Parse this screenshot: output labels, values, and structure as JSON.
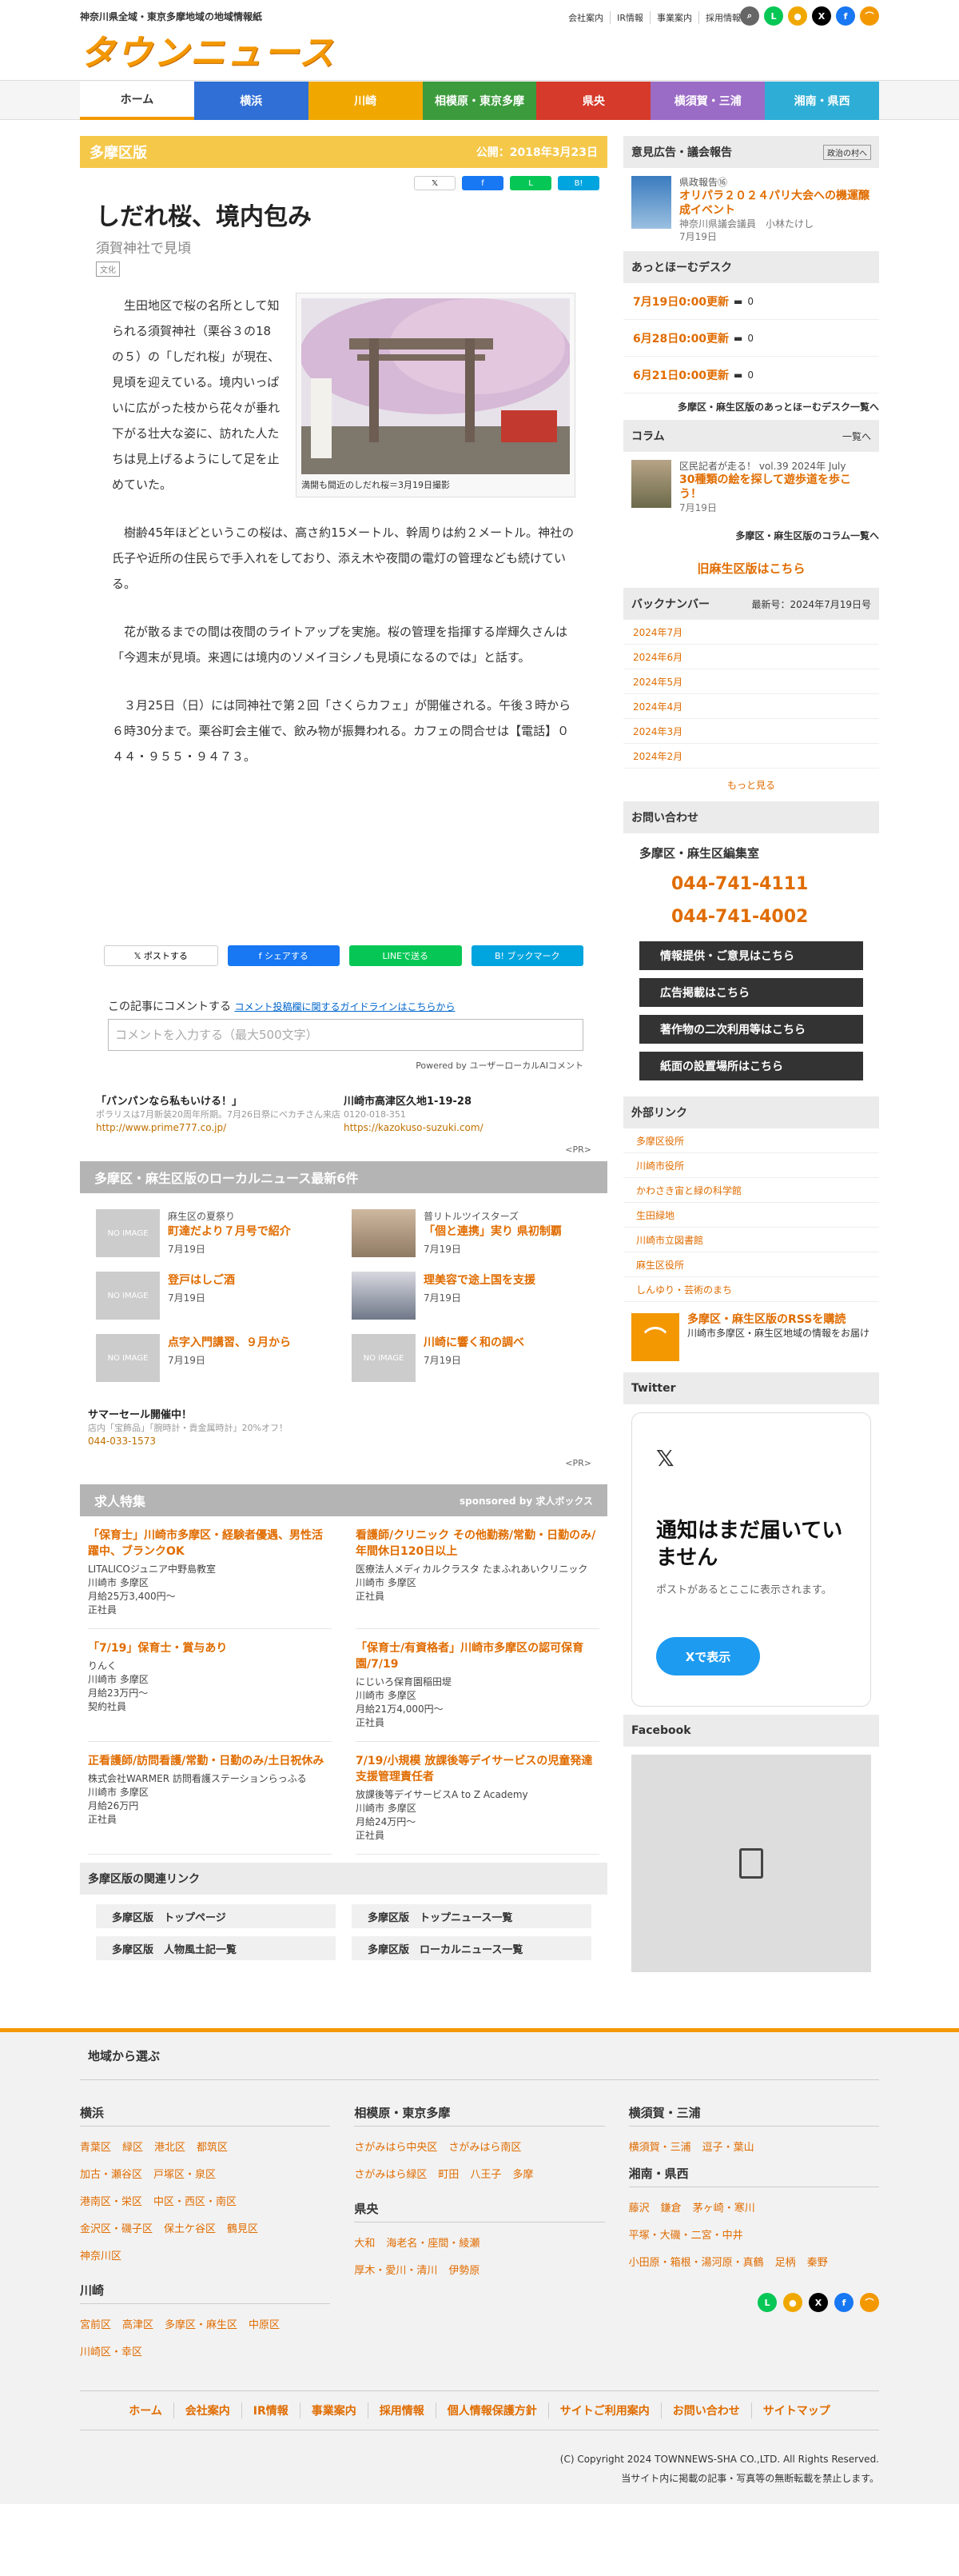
{
  "header": {
    "tagline": "神奈川県全域・東京多摩地域の地域情報紙",
    "logo": "タウンニュース",
    "links": [
      "会社案内",
      "IR情報",
      "事業案内",
      "採用情報"
    ]
  },
  "nav": [
    "ホーム",
    "横浜",
    "川崎",
    "相模原・東京多摩",
    "県央",
    "横須賀・三浦",
    "湘南・県西"
  ],
  "nav_colors": [
    "#ffffff",
    "#2f6fd6",
    "#f0a800",
    "#3c9b3c",
    "#d63a2a",
    "#9b6cc6",
    "#2eaed6"
  ],
  "article": {
    "area": "多摩区版",
    "published": "公開：2018年3月23日",
    "title": "しだれ桜、境内包み",
    "subtitle": "須賀神社で見頃",
    "tag": "文化",
    "caption": "満開も間近のしだれ桜＝3月19日撮影",
    "paragraphs": [
      "生田地区で桜の名所として知られる須賀神社（栗谷３の18の５）の「しだれ桜」が現在、見頃を迎えている。境内いっぱいに広がった枝から花々が垂れ下がる壮大な姿に、訪れた人たちは見上げるようにして足を止めていた。",
      "樹齢45年ほどというこの桜は、高さ約15メートル、幹周りは約２メートル。神社の氏子や近所の住民らで手入れをしており、添え木や夜間の電灯の管理なども続けている。",
      "花が散るまでの間は夜間のライトアップを実施。桜の管理を指揮する岸輝久さんは「今週末が見頃。来週には境内のソメイヨシノも見頃になるのでは」と話す。",
      "３月25日（日）には同神社で第２回「さくらカフェ」が開催される。午後３時から６時30分まで。栗谷町会主催で、飲み物が振舞われる。カフェの問合せは【電話】０４４・９５５・９４７３。"
    ]
  },
  "share": {
    "post": "ポストする",
    "fb": "シェアする",
    "line": "LINEで送る",
    "hb": "ブックマーク"
  },
  "comment": {
    "label": "この記事にコメントする",
    "guide": "コメント投稿欄に関するガイドラインはこちらから",
    "placeholder": "コメントを入力する（最大500文字）",
    "powered": "Powered by ユーザーローカルAIコメント"
  },
  "ads": [
    {
      "title": "「パンパンなら私もいける！」",
      "desc": "ポラリスは7月新装20周年所期。7月26日祭にべカチさん来店",
      "url": "http://www.prime777.co.jp/"
    },
    {
      "title": "川崎市高津区久地1-19-28",
      "desc": "0120-018-351",
      "url": "https://kazokuso-suzuki.com/"
    }
  ],
  "pr": "<PR>",
  "local": {
    "heading": "多摩区・麻生区版のローカルニュース最新6件",
    "items": [
      {
        "kicker": "麻生区の夏祭り",
        "title": "町達だより７月号で紹介",
        "date": "7月19日",
        "photo": false
      },
      {
        "kicker": "普リトルツイスターズ",
        "title": "「個と連携」実り 県初制覇",
        "date": "7月19日",
        "photo": true
      },
      {
        "kicker": "",
        "title": "登戸はしご酒",
        "date": "7月19日",
        "photo": false
      },
      {
        "kicker": "",
        "title": "理美容で途上国を支援",
        "date": "7月19日",
        "photo": true
      },
      {
        "kicker": "",
        "title": "点字入門講習、９月から",
        "date": "7月19日",
        "photo": false
      },
      {
        "kicker": "",
        "title": "川崎に響く和の調べ",
        "date": "7月19日",
        "photo": false
      }
    ],
    "noimage": "NO IMAGE"
  },
  "sale": {
    "title": "サマーセール開催中！",
    "desc": "店内「宝飾品」「腕時計・貴金属時計」20%オフ！",
    "tel": "044-033-1573"
  },
  "jobs": {
    "heading": "求人特集",
    "sponsor": "sponsored by 求人ボックス",
    "items": [
      {
        "title": "「保育士」川崎市多摩区・経験者優遇、男性活躍中、ブランクOK",
        "company": "LITALICOジュニア中野島教室",
        "loc": "川崎市 多摩区",
        "pay": "月給25万3,400円〜",
        "type": "正社員"
      },
      {
        "title": "看護師/クリニック その他勤務/常勤・日勤のみ/年間休日120日以上",
        "company": "医療法人メディカルクラスタ たまふれあいクリニック",
        "loc": "川崎市 多摩区",
        "pay": "",
        "type": "正社員"
      },
      {
        "title": "「7/19」保育士・賞与あり",
        "company": "りんく",
        "loc": "川崎市 多摩区",
        "pay": "月給23万円〜",
        "type": "契約社員"
      },
      {
        "title": "「保育士/有資格者」川崎市多摩区の認可保育園/7/19",
        "company": "にじいろ保育園稲田堤",
        "loc": "川崎市 多摩区",
        "pay": "月給21万4,000円〜",
        "type": "正社員"
      },
      {
        "title": "正看護師/訪問看護/常勤・日勤のみ/土日祝休み",
        "company": "株式会社WARMER 訪問看護ステーションらっふる",
        "loc": "川崎市 多摩区",
        "pay": "月給26万円",
        "type": "正社員"
      },
      {
        "title": "7/19/小規模 放課後等デイサービスの児童発達支援管理責任者",
        "company": "放課後等デイサービスA to Z Academy",
        "loc": "川崎市 多摩区",
        "pay": "月給24万円〜",
        "type": "正社員"
      }
    ]
  },
  "related": {
    "heading": "多摩区版の関連リンク",
    "links": [
      "多摩区版　トップページ",
      "多摩区版　トップニュース一覧",
      "多摩区版　人物風土記一覧",
      "多摩区版　ローカルニュース一覧"
    ]
  },
  "side": {
    "ads_heading": "意見広告・議会報告",
    "ads_badge": "政治の村へ",
    "report": {
      "kicker": "県政報告⑯",
      "title": "オリパラ２０２４パリ大会への機運醸成イベント",
      "author": "神奈川県議会議員　小林たけし",
      "date": "7月19日"
    },
    "athome_heading": "あっとほーむデスク",
    "updates": [
      {
        "date": "7月19日0:00更新",
        "count": "0"
      },
      {
        "date": "6月28日0:00更新",
        "count": "0"
      },
      {
        "date": "6月21日0:00更新",
        "count": "0"
      }
    ],
    "athome_more": "多摩区・麻生区版のあっとほーむデスク一覧へ",
    "column_heading": "コラム",
    "column_list": "一覧へ",
    "column": {
      "kicker": "区民記者が走る！ vol.39 2024年 July",
      "title": "30種類の絵を探して遊歩道を歩こう！",
      "date": "7月19日"
    },
    "column_more": "多摩区・麻生区版のコラム一覧へ",
    "old": "旧麻生区版はこちら",
    "backnum_heading": "バックナンバー",
    "backnum_latest": "最新号：2024年7月19日号",
    "backnum": [
      "2024年7月",
      "2024年6月",
      "2024年5月",
      "2024年4月",
      "2024年3月",
      "2024年2月"
    ],
    "backnum_more": "もっと見る",
    "contact_heading": "お問い合わせ",
    "contact_name": "多摩区・麻生区編集室",
    "tel1": "044-741-4111",
    "tel2": "044-741-4002",
    "buttons": [
      "情報提供・ご意見はこちら",
      "広告掲載はこちら",
      "著作物の二次利用等はこちら",
      "紙面の設置場所はこちら"
    ],
    "ext_heading": "外部リンク",
    "ext": [
      "多摩区役所",
      "川崎市役所",
      "かわさき宙と緑の科学館",
      "生田緑地",
      "川崎市立図書館",
      "麻生区役所",
      "しんゆり・芸術のまち"
    ],
    "rss_title": "多摩区・麻生区版のRSSを購読",
    "rss_desc": "川崎市多摩区・麻生区地域の情報をお届け",
    "twitter_heading": "Twitter",
    "tw_title": "通知はまだ届いていません",
    "tw_desc": "ポストがあるとここに表示されます。",
    "tw_btn": "Xで表示",
    "fb_heading": "Facebook"
  },
  "footer": {
    "heading": "地域から選ぶ",
    "cols": [
      [
        {
          "region": "横浜",
          "areas": [
            "青葉区",
            "緑区",
            "港北区",
            "都筑区",
            "加古・瀬谷区",
            "戸塚区・泉区",
            "港南区・栄区",
            "中区・西区・南区",
            "金沢区・磯子区",
            "保土ケ谷区",
            "鶴見区",
            "神奈川区"
          ]
        },
        {
          "region": "川崎",
          "areas": [
            "宮前区",
            "高津区",
            "多摩区・麻生区",
            "中原区",
            "川崎区・幸区"
          ]
        }
      ],
      [
        {
          "region": "相模原・東京多摩",
          "areas": [
            "さがみはら中央区",
            "さがみはら南区",
            "さがみはら緑区",
            "町田",
            "八王子",
            "多摩"
          ]
        },
        {
          "region": "県央",
          "areas": [
            "大和",
            "海老名・座間・綾瀬",
            "厚木・愛川・清川",
            "伊勢原"
          ]
        }
      ],
      [
        {
          "region": "横須賀・三浦",
          "areas": [
            "横須賀・三浦",
            "逗子・葉山"
          ]
        },
        {
          "region": "湘南・県西",
          "areas": [
            "藤沢",
            "鎌倉",
            "茅ヶ崎・寒川",
            "平塚・大磯・二宮・中井",
            "小田原・箱根・湯河原・真鶴",
            "足柄",
            "秦野"
          ]
        }
      ]
    ],
    "nav": [
      "ホーム",
      "会社案内",
      "IR情報",
      "事業案内",
      "採用情報",
      "個人情報保護方針",
      "サイトご利用案内",
      "お問い合わせ",
      "サイトマップ"
    ],
    "copyright": "(C) Copyright 2024 TOWNNEWS-SHA CO.,LTD. All Rights Reserved.",
    "notice": "当サイト内に掲載の記事・写真等の無断転載を禁止します。"
  }
}
